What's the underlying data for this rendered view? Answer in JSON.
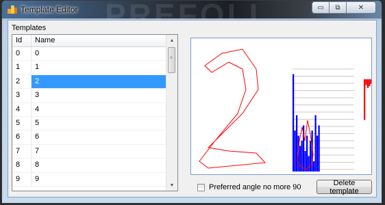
{
  "window": {
    "title": "Template Editor",
    "colors": {
      "selection": "#3399ff",
      "hist_bar": "#0000ff",
      "outline": "#ff0000",
      "signature": "#ff0000"
    }
  },
  "caption_buttons": {
    "minimize": "▭",
    "maximize": "⧉",
    "close": "✕"
  },
  "templates": {
    "label": "Templates",
    "columns": [
      "Id",
      "Name"
    ],
    "rows": [
      {
        "id": "0",
        "name": "0"
      },
      {
        "id": "1",
        "name": "1"
      },
      {
        "id": "2",
        "name": "2"
      },
      {
        "id": "3",
        "name": "3"
      },
      {
        "id": "4",
        "name": "4"
      },
      {
        "id": "5",
        "name": "5"
      },
      {
        "id": "6",
        "name": "6"
      },
      {
        "id": "7",
        "name": "7"
      },
      {
        "id": "8",
        "name": "8"
      },
      {
        "id": "9",
        "name": "9"
      }
    ],
    "selected_index": 2
  },
  "preview": {
    "histogram_values": [
      0.95,
      0.4,
      0.55,
      0.35,
      0.25,
      0.3,
      0.45,
      0.2,
      0.35,
      0.15,
      0.3,
      0.4,
      0.1,
      0.55,
      0.35,
      0.45
    ],
    "signature_values": [
      0.7,
      0.1,
      0.15,
      0.12,
      0.08
    ]
  },
  "options": {
    "preferred_angle_label": "Preferred angle no more 90",
    "preferred_angle_checked": false
  },
  "actions": {
    "delete_label": "Delete template"
  }
}
